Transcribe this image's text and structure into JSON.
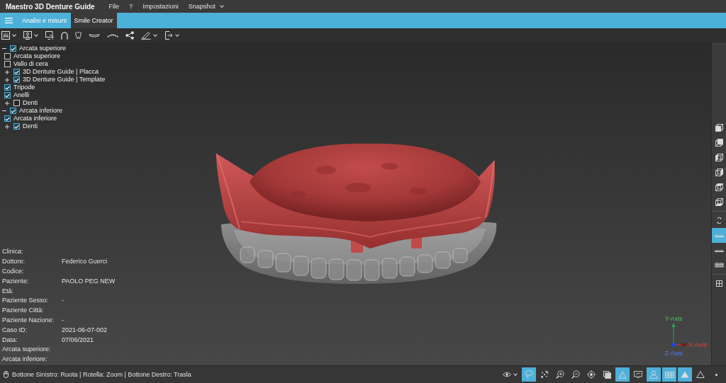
{
  "window": {
    "title": "Maestro 3D Denture Guide"
  },
  "menu": [
    {
      "label": "File",
      "dropdown": false
    },
    {
      "label": "?",
      "dropdown": false
    },
    {
      "label": "Impostazioni",
      "dropdown": false
    },
    {
      "label": "Snapshot",
      "dropdown": true
    }
  ],
  "ribbon_tabs": [
    {
      "label": "Analisi e misure",
      "selected": false
    },
    {
      "label": "Smile Creator",
      "selected": true
    }
  ],
  "toolbar": [
    {
      "dropdown": true
    },
    {
      "dropdown": true
    },
    {
      "dropdown": false
    },
    {
      "dropdown": false
    },
    {
      "dropdown": false
    },
    {
      "dropdown": false
    },
    {
      "dropdown": false
    },
    {
      "dropdown": false
    },
    {
      "dropdown": true
    },
    {
      "dropdown": true
    }
  ],
  "model_tree": [
    {
      "label": "Arcata superiore",
      "checked": true,
      "expanded": true,
      "children": [
        {
          "label": "Arcata superiore",
          "checked": false
        },
        {
          "label": "Vallo di cera",
          "checked": false
        },
        {
          "label": "3D Denture Guide | Placca",
          "checked": true,
          "expanded": false
        },
        {
          "label": "3D Denture Guide | Template",
          "checked": true,
          "expanded": false
        },
        {
          "label": "Tripode",
          "checked": true
        },
        {
          "label": "Anelli",
          "checked": true
        },
        {
          "label": "Denti",
          "checked": false,
          "expanded": false
        }
      ]
    },
    {
      "label": "Arcata inferiore",
      "checked": true,
      "expanded": true,
      "children": [
        {
          "label": "Arcata inferiore",
          "checked": true
        },
        {
          "label": "Denti",
          "checked": true,
          "expanded": false
        }
      ]
    }
  ],
  "case_info": [
    {
      "label": "Clinica:"
    },
    {
      "label": "Dottore:",
      "value": "Federico Guerci"
    },
    {
      "label": "Codice:"
    },
    {
      "label": "Paziente:",
      "value": "PAOLO PEG NEW"
    },
    {
      "label": "Età:"
    },
    {
      "label": "Paziente Sesso:",
      "value": "-"
    },
    {
      "label": "Paziente Città:"
    },
    {
      "label": "Paziente Nazione:",
      "value": "-"
    },
    {
      "label": "Caso ID:",
      "value": "2021-06-07-002"
    },
    {
      "label": "Data:",
      "value": "07/06/2021"
    },
    {
      "label": "Arcata superiore:"
    },
    {
      "label": "Arcata inferiore:"
    }
  ],
  "axes_gizmo": {
    "y_label": "Y-Axis",
    "x_label": "X-Axis",
    "z_label": "Z-Axis"
  },
  "view_buttons": [
    {
      "selected": false
    },
    {
      "selected": false
    },
    {
      "selected": false
    },
    {
      "selected": false
    },
    {
      "selected": false
    },
    {
      "selected": false
    },
    {
      "selected": false
    },
    {
      "selected": true
    },
    {
      "selected": false
    },
    {
      "selected": false
    },
    {
      "selected": false
    }
  ],
  "status_bar": {
    "hint": "Bottone Sinistro: Ruota | Rotella: Zoom | Bottone Destro: Trasla",
    "tools": [
      {
        "on": false,
        "dropdown": true
      },
      {
        "on": true,
        "dropdown": false
      },
      {
        "on": false,
        "dropdown": false
      },
      {
        "on": false,
        "dropdown": false
      },
      {
        "on": false,
        "dropdown": false
      },
      {
        "on": false,
        "dropdown": false
      },
      {
        "on": false,
        "dropdown": false
      },
      {
        "on": true,
        "dropdown": false
      },
      {
        "on": false,
        "dropdown": false
      },
      {
        "on": true,
        "dropdown": false
      },
      {
        "on": true,
        "dropdown": false
      },
      {
        "on": true,
        "dropdown": false
      },
      {
        "on": false,
        "dropdown": false
      },
      {
        "on": false,
        "dropdown": false
      }
    ]
  }
}
